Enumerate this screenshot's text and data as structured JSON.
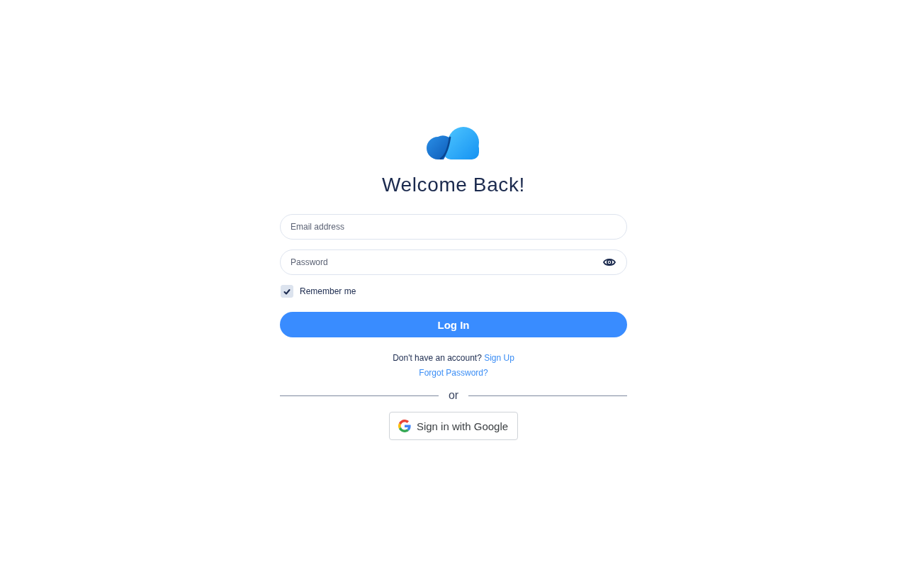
{
  "title": "Welcome Back!",
  "fields": [
    {
      "kind": "email",
      "placeholder": "Email address"
    },
    {
      "kind": "password",
      "placeholder": "Password"
    }
  ],
  "remember": {
    "label": "Remember me",
    "checked": true
  },
  "login_button": "Log In",
  "signup_prompt": {
    "text": "Don't have an account?",
    "link": "Sign Up"
  },
  "forgot_link": "Forgot Password?",
  "divider": "or",
  "google_button": "Sign in with Google"
}
